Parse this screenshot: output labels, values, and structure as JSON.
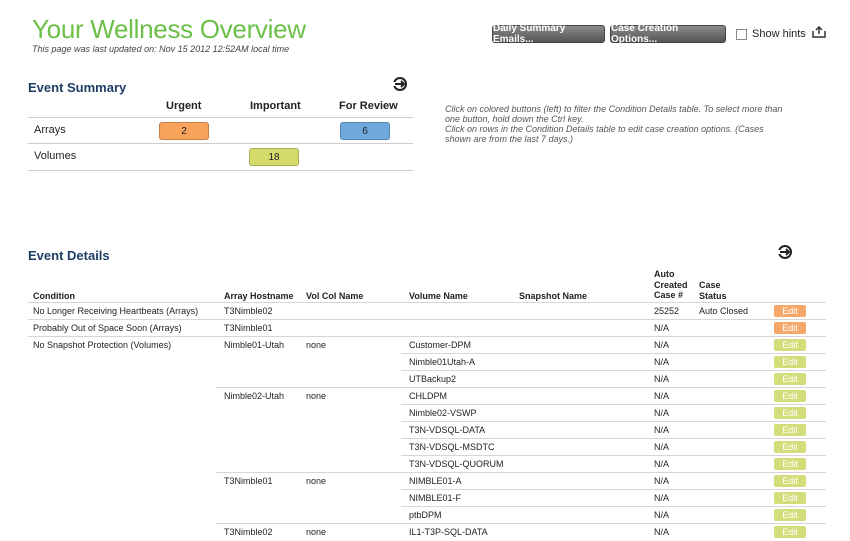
{
  "header": {
    "title": "Your Wellness Overview",
    "updated": "This page was last updated on: Nov 15 2012 12:52AM local time",
    "daily_emails_label": "Daily Summary Emails...",
    "case_options_label": "Case Creation Options...",
    "show_hints_label": "Show hints"
  },
  "summary": {
    "title": "Event Summary",
    "columns": [
      "Urgent",
      "Important",
      "For Review"
    ],
    "rows": [
      {
        "label": "Arrays",
        "urgent": "2",
        "important": "",
        "review": "6"
      },
      {
        "label": "Volumes",
        "urgent": "",
        "important": "18",
        "review": ""
      }
    ],
    "help1": "Click on colored buttons (left) to filter the Condition Details table.  To select more than one button, hold down the Ctrl key.",
    "help2": "Click on rows in the Condition Details table to edit case creation options.  (Cases shown are from the last 7 days.)"
  },
  "details": {
    "title": "Event Details",
    "headers": {
      "condition": "Condition",
      "hostname": "Array Hostname",
      "volcol": "Vol Col Name",
      "volume": "Volume Name",
      "snapshot": "Snapshot Name",
      "autocase": "Auto Created Case #",
      "status": "Case Status"
    },
    "auto_line1": "Auto",
    "auto_line2": "Created",
    "auto_line3": "Case #",
    "status_line1": "Case",
    "status_line2": "Status",
    "edit_label": "Edit",
    "rows": [
      {
        "condition": "No Longer Receiving Heartbeats (Arrays)",
        "host": "T3Nimble02",
        "volcol": "",
        "volume": "",
        "snapshot": "",
        "case": "25252",
        "status": "Auto Closed",
        "sev": "urgent"
      },
      {
        "condition": "Probably Out of Space Soon (Arrays)",
        "host": "T3Nimble01",
        "volcol": "",
        "volume": "",
        "snapshot": "",
        "case": "N/A",
        "status": "",
        "sev": "urgent"
      },
      {
        "condition": "No Snapshot Protection (Volumes)",
        "host": "Nimble01-Utah",
        "volcol": "none",
        "volume": "Customer-DPM",
        "snapshot": "",
        "case": "N/A",
        "status": "",
        "sev": "important"
      },
      {
        "condition": "",
        "host": "",
        "volcol": "",
        "volume": "Nimble01Utah-A",
        "snapshot": "",
        "case": "N/A",
        "status": "",
        "sev": "important"
      },
      {
        "condition": "",
        "host": "",
        "volcol": "",
        "volume": "UTBackup2",
        "snapshot": "",
        "case": "N/A",
        "status": "",
        "sev": "important"
      },
      {
        "condition": "",
        "host": "Nimble02-Utah",
        "volcol": "none",
        "volume": "CHLDPM",
        "snapshot": "",
        "case": "N/A",
        "status": "",
        "sev": "important"
      },
      {
        "condition": "",
        "host": "",
        "volcol": "",
        "volume": "Nimble02-VSWP",
        "snapshot": "",
        "case": "N/A",
        "status": "",
        "sev": "important"
      },
      {
        "condition": "",
        "host": "",
        "volcol": "",
        "volume": "T3N-VDSQL-DATA",
        "snapshot": "",
        "case": "N/A",
        "status": "",
        "sev": "important"
      },
      {
        "condition": "",
        "host": "",
        "volcol": "",
        "volume": "T3N-VDSQL-MSDTC",
        "snapshot": "",
        "case": "N/A",
        "status": "",
        "sev": "important"
      },
      {
        "condition": "",
        "host": "",
        "volcol": "",
        "volume": "T3N-VDSQL-QUORUM",
        "snapshot": "",
        "case": "N/A",
        "status": "",
        "sev": "important"
      },
      {
        "condition": "",
        "host": "T3Nimble01",
        "volcol": "none",
        "volume": "NIMBLE01-A",
        "snapshot": "",
        "case": "N/A",
        "status": "",
        "sev": "important"
      },
      {
        "condition": "",
        "host": "",
        "volcol": "",
        "volume": "NIMBLE01-F",
        "snapshot": "",
        "case": "N/A",
        "status": "",
        "sev": "important"
      },
      {
        "condition": "",
        "host": "",
        "volcol": "",
        "volume": "ptbDPM",
        "snapshot": "",
        "case": "N/A",
        "status": "",
        "sev": "important"
      },
      {
        "condition": "",
        "host": "T3Nimble02",
        "volcol": "none",
        "volume": "IL1-T3P-SQL-DATA",
        "snapshot": "",
        "case": "N/A",
        "status": "",
        "sev": "important"
      }
    ]
  },
  "colors": {
    "title_green": "#6cc04a",
    "heading_blue": "#1f3e66",
    "urgent": "#f7a35c",
    "important": "#d4db6a",
    "review": "#6fa8dc",
    "edit_urgent": "#f5a86a",
    "edit_important": "#d3de7a"
  }
}
